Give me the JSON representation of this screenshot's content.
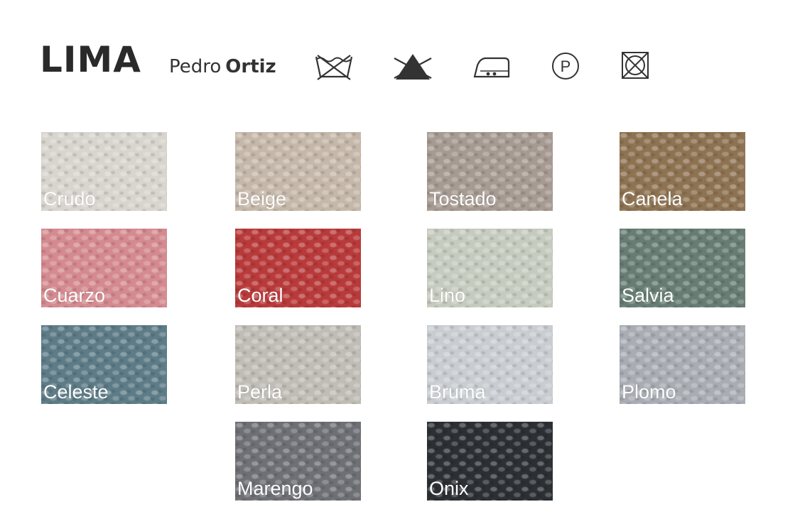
{
  "header": {
    "title": "LIMA",
    "brand_first": "Pedro",
    "brand_second": "Ortiz"
  },
  "care_icons": [
    "hand-wash-crossed-icon",
    "no-bleach-icon",
    "iron-two-dots-icon",
    "dry-clean-p-icon",
    "no-tumble-dry-icon"
  ],
  "swatches": [
    {
      "name": "Crudo",
      "color": "#d8d4ce"
    },
    {
      "name": "Beige",
      "color": "#c5b8aa"
    },
    {
      "name": "Tostado",
      "color": "#a69a92"
    },
    {
      "name": "Canela",
      "color": "#8e7352"
    },
    {
      "name": "Cuarzo",
      "color": "#d48a90"
    },
    {
      "name": "Coral",
      "color": "#b93a3a"
    },
    {
      "name": "Lino",
      "color": "#c6cbbf"
    },
    {
      "name": "Salvia",
      "color": "#677d74"
    },
    {
      "name": "Celeste",
      "color": "#5d7c87"
    },
    {
      "name": "Perla",
      "color": "#c0bdb6"
    },
    {
      "name": "Bruma",
      "color": "#c9cdd1"
    },
    {
      "name": "Plomo",
      "color": "#a9adb3"
    },
    {
      "name": "Marengo",
      "color": "#6e7075"
    },
    {
      "name": "Onix",
      "color": "#2c2f33"
    }
  ]
}
